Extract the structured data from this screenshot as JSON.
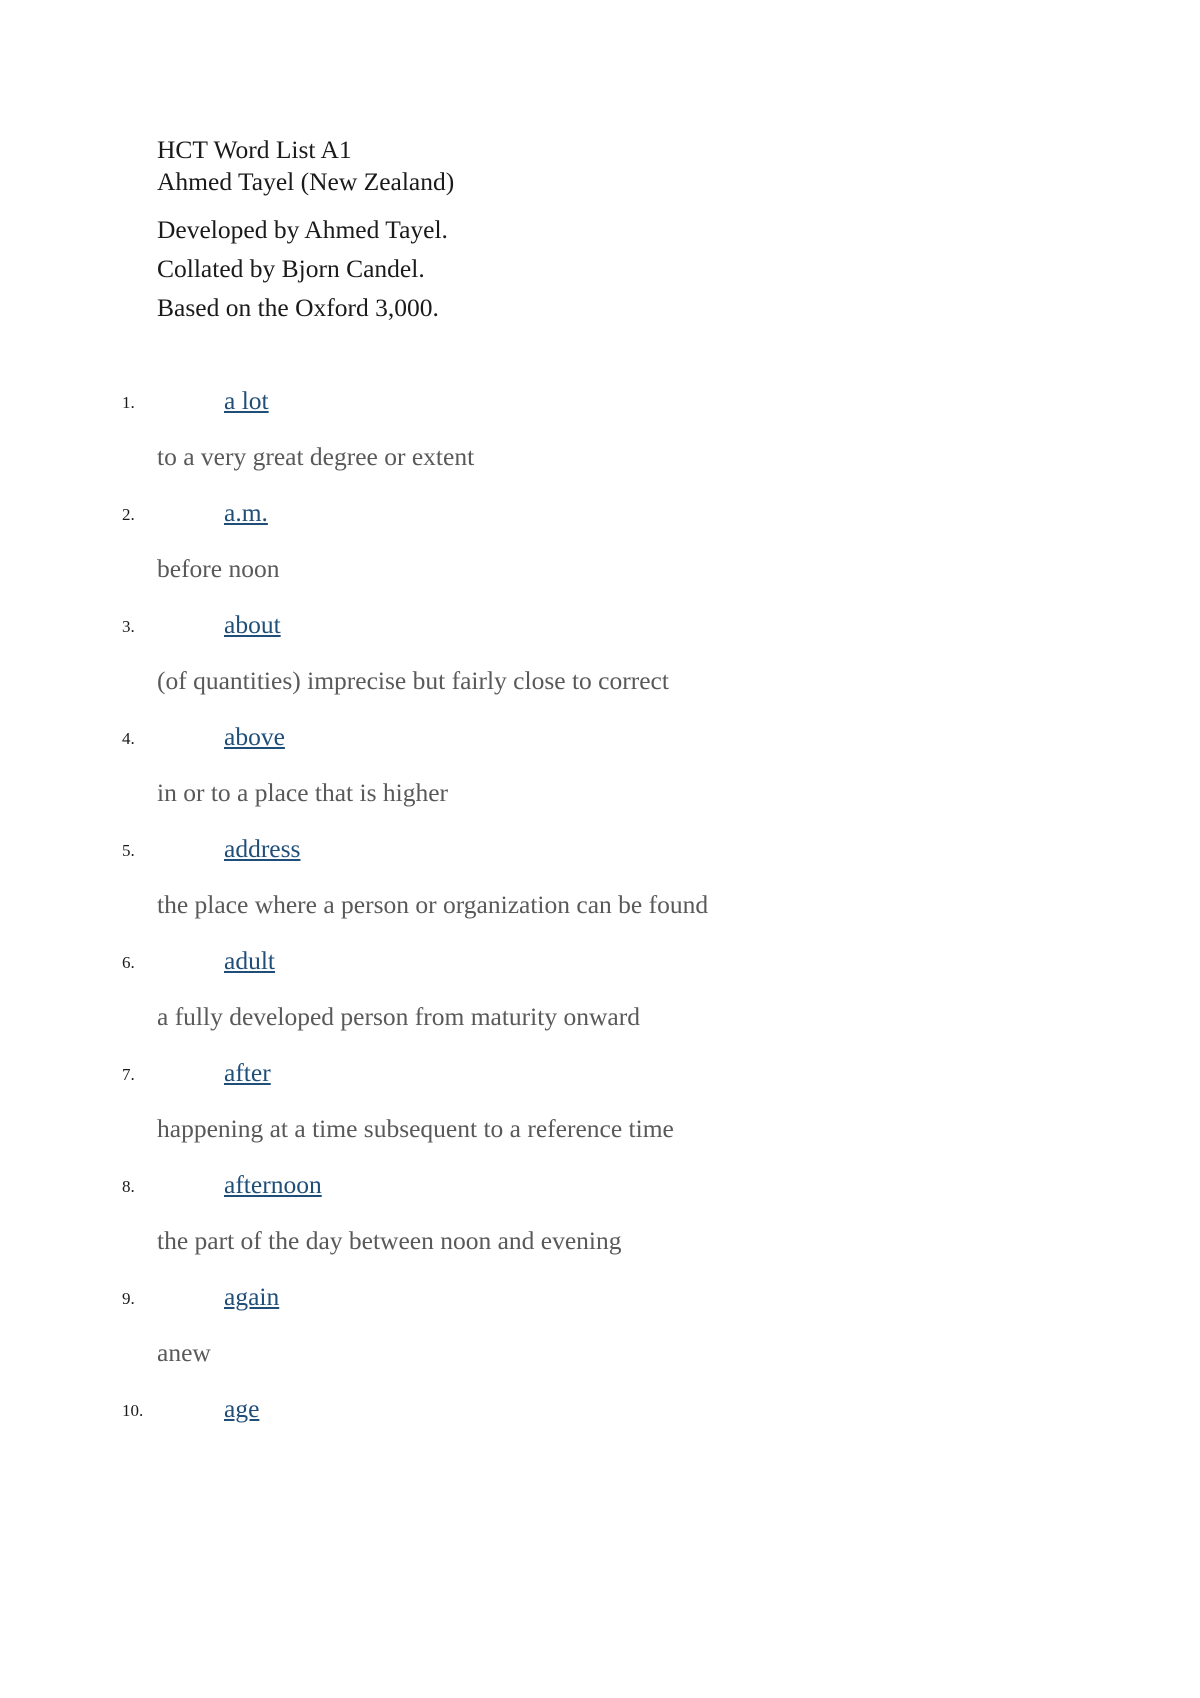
{
  "document": {
    "title": "HCT Word List A1",
    "author": "Ahmed Tayel (New Zealand)",
    "credits": [
      "Developed by Ahmed Tayel.",
      "Collated by Bjorn Candel.",
      "Based on the Oxford 3,000."
    ]
  },
  "colors": {
    "page_background": "#ffffff",
    "heading_text": "#1a1a1a",
    "link": "#1F4E79",
    "definition_text": "#595959",
    "number_marker": "#1a1a1a"
  },
  "entries": [
    {
      "number": "1.",
      "term": "a lot",
      "definition": "to a very great degree or extent"
    },
    {
      "number": "2.",
      "term": "a.m.",
      "definition": "before noon"
    },
    {
      "number": "3.",
      "term": "about",
      "definition": "(of quantities) imprecise but fairly close to correct"
    },
    {
      "number": "4.",
      "term": "above",
      "definition": "in or to a place that is higher"
    },
    {
      "number": "5.",
      "term": "address",
      "definition": "the place where a person or organization can be found"
    },
    {
      "number": "6.",
      "term": "adult",
      "definition": "a fully developed person from maturity onward"
    },
    {
      "number": "7.",
      "term": "after",
      "definition": "happening at a time subsequent to a reference time"
    },
    {
      "number": "8.",
      "term": "afternoon",
      "definition": "the part of the day between noon and evening"
    },
    {
      "number": "9.",
      "term": "again",
      "definition": "anew"
    },
    {
      "number": "10.",
      "term": "age",
      "definition": ""
    }
  ]
}
